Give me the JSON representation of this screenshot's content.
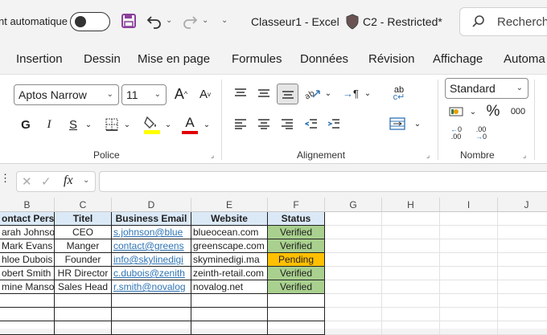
{
  "titlebar": {
    "autosave_label": "nt automatique",
    "doc_title": "Classeur1  -  Excel",
    "sensitivity_label": "C2 - Restricted*",
    "search_text": "Recherch"
  },
  "tabs": [
    "Insertion",
    "Dessin",
    "Mise en page",
    "Formules",
    "Données",
    "Révision",
    "Affichage",
    "Automa"
  ],
  "ribbon": {
    "font_name": "Aptos Narrow",
    "font_size": "11",
    "number_format": "Standard",
    "bold": "G",
    "italic": "I",
    "underline": "S",
    "grow": "A",
    "shrink": "A",
    "font_color_letter": "A",
    "percent": "%",
    "thousands": "000",
    "groups": {
      "police": "Police",
      "alignement": "Alignement",
      "nombre": "Nombre"
    },
    "accent_colors": {
      "highlight": "#ffff00",
      "font_color": "#e00000",
      "save_icon": "#8b3f9b"
    }
  },
  "formula_bar": {
    "fx_label": "fx",
    "value": ""
  },
  "columns": [
    "B",
    "C",
    "D",
    "E",
    "F",
    "G",
    "H",
    "I",
    "J"
  ],
  "table": {
    "headers": [
      "ontact Person",
      "Titel",
      "Business Email",
      "Website",
      "Status"
    ],
    "rows": [
      [
        "arah Johnson",
        "CEO",
        "s.johnson@blue",
        "blueocean.com",
        "Verified"
      ],
      [
        "Mark Evans",
        "Manger",
        "contact@greens",
        "greenscape.com",
        "Verified"
      ],
      [
        "hloe Dubois",
        "Founder",
        "info@skylinedigi",
        "skyminedigi.ma",
        "Pending"
      ],
      [
        "obert Smith",
        "HR Director",
        "c.dubois@zenith",
        "zeinth-retail.com",
        "Verified"
      ],
      [
        "mine Mansouri",
        "Sales Head",
        "r.smith@novalog",
        "novalog.net",
        "Verified"
      ]
    ]
  }
}
